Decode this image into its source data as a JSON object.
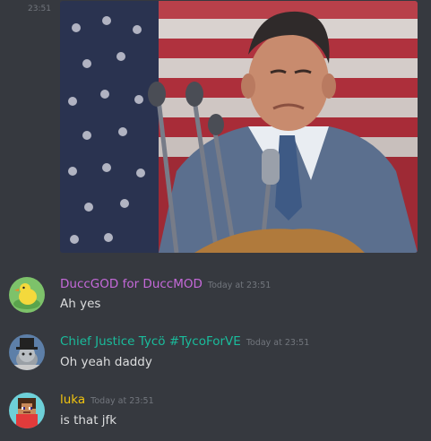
{
  "leading_timestamp": "23:51",
  "attachment": {
    "alt_subject": "image"
  },
  "messages": [
    {
      "username": "DuccGOD for DuccMOD",
      "username_color": "#c569d9",
      "time": "Today at 23:51",
      "text": "Ah yes",
      "avatar": "duck-avatar"
    },
    {
      "username": "Chief Justice Tycö #TycoForVE",
      "username_color": "#1abc9c",
      "time": "Today at 23:51",
      "text": "Oh yeah daddy",
      "avatar": "top-hat-cat-avatar"
    },
    {
      "username": "luka",
      "username_color": "#f1c40f",
      "time": "Today at 23:51",
      "text": "is that jfk",
      "avatar": "pixel-character-avatar"
    }
  ],
  "colors": {
    "background": "#36393f",
    "text": "#dcddde",
    "muted": "#72767d"
  }
}
